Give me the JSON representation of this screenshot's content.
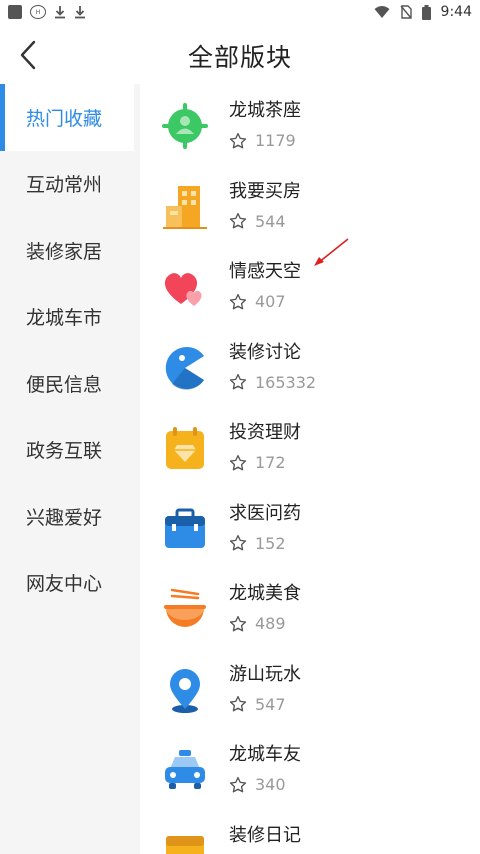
{
  "status": {
    "time": "9:44"
  },
  "header": {
    "title": "全部版块"
  },
  "sidebar": {
    "items": [
      {
        "label": "热门收藏",
        "active": true
      },
      {
        "label": "互动常州"
      },
      {
        "label": "装修家居"
      },
      {
        "label": "龙城车市"
      },
      {
        "label": "便民信息"
      },
      {
        "label": "政务互联"
      },
      {
        "label": "兴趣爱好"
      },
      {
        "label": "网友中心"
      }
    ]
  },
  "forums": [
    {
      "name": "龙城茶座",
      "count": "1179",
      "icon": "community-target-icon",
      "color": "#3cc864"
    },
    {
      "name": "我要买房",
      "count": "544",
      "icon": "building-icon",
      "color": "#f5a623"
    },
    {
      "name": "情感天空",
      "count": "407",
      "icon": "hearts-icon",
      "color": "#f2455a"
    },
    {
      "name": "装修讨论",
      "count": "165332",
      "icon": "pacman-icon",
      "color": "#2e8ce6"
    },
    {
      "name": "投资理财",
      "count": "172",
      "icon": "calendar-diamond-icon",
      "color": "#f5b21c"
    },
    {
      "name": "求医问药",
      "count": "152",
      "icon": "medical-kit-icon",
      "color": "#2e8ce6"
    },
    {
      "name": "龙城美食",
      "count": "489",
      "icon": "noodle-bowl-icon",
      "color": "#f57b25"
    },
    {
      "name": "游山玩水",
      "count": "547",
      "icon": "location-pin-icon",
      "color": "#2e8ce6"
    },
    {
      "name": "龙城车友",
      "count": "340",
      "icon": "car-icon",
      "color": "#2e8ce6"
    },
    {
      "name": "装修日记",
      "count": "",
      "icon": "box-icon",
      "color": "#f5b21c"
    }
  ]
}
